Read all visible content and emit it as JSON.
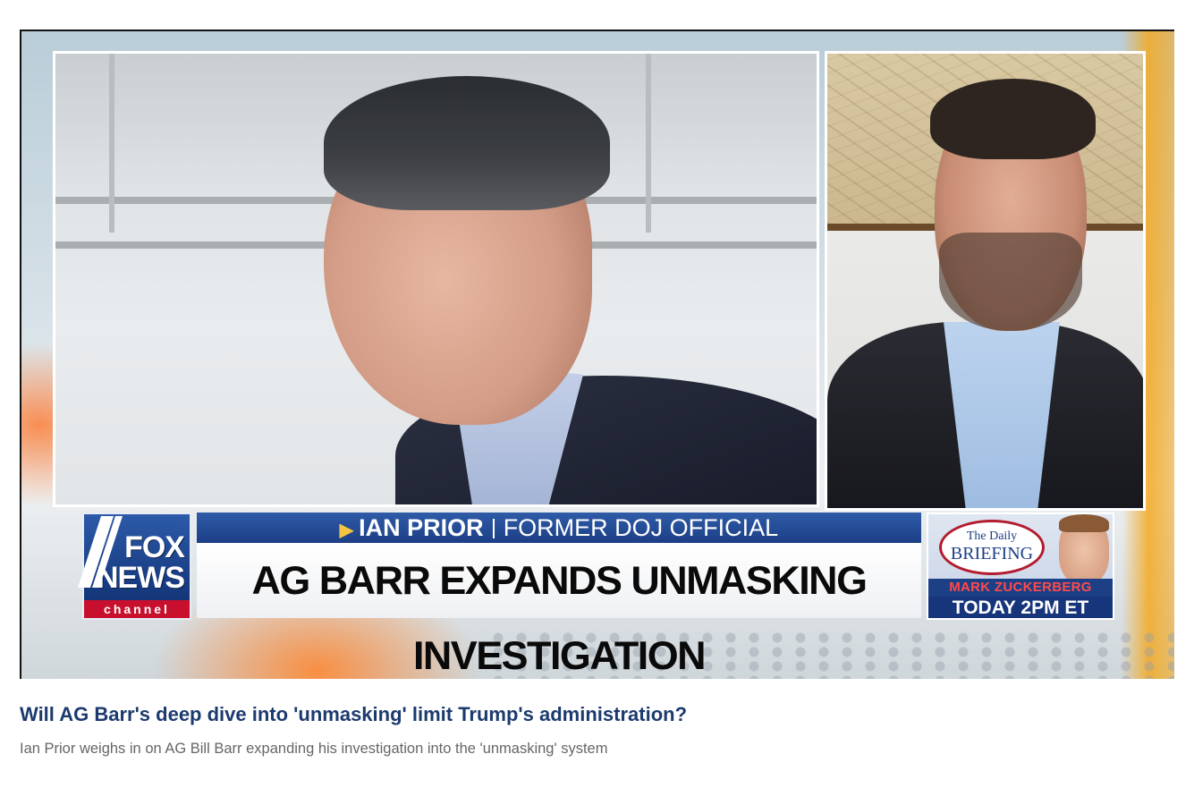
{
  "video": {
    "lower_third": {
      "name": "IAN PRIOR",
      "role": "FORMER DOJ OFFICIAL",
      "headline": "AG BARR EXPANDS UNMASKING INVESTIGATION"
    },
    "network_logo": {
      "line1": "FOX",
      "line2": "NEWS",
      "line3": "channel"
    },
    "promo": {
      "show_line1": "The Daily",
      "show_line2": "BRIEFING",
      "guest": "MARK ZUCKERBERG",
      "time": "TODAY 2PM ET"
    }
  },
  "article": {
    "title": "Will AG Barr's deep dive into 'unmasking' limit Trump's administration?",
    "description": "Ian Prior weighs in on AG Bill Barr expanding his investigation into the 'unmasking' system"
  },
  "colors": {
    "title": "#1c3a6e",
    "description": "#666666",
    "fox_blue": "#1c3f86",
    "fox_red": "#c8102e"
  }
}
